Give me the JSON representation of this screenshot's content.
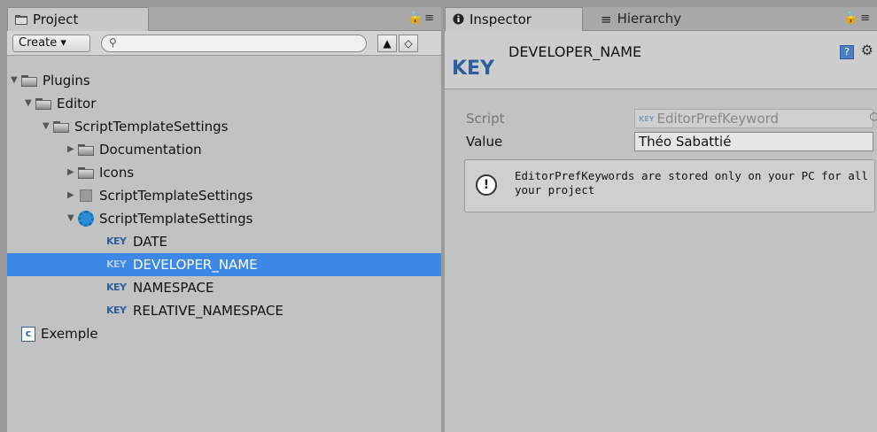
{
  "project": {
    "tab_label": "Project",
    "create_label": "Create ▾",
    "search_placeholder": "",
    "tree": [
      {
        "label": "Plugins",
        "type": "folder",
        "expanded": true
      },
      {
        "label": "Editor",
        "type": "folder",
        "expanded": true
      },
      {
        "label": "ScriptTemplateSettings",
        "type": "folder",
        "expanded": true
      },
      {
        "label": "Documentation",
        "type": "folder",
        "expanded": false
      },
      {
        "label": "Icons",
        "type": "folder",
        "expanded": false
      },
      {
        "label": "ScriptTemplateSettings",
        "type": "script",
        "expanded": false
      },
      {
        "label": "ScriptTemplateSettings",
        "type": "asset",
        "expanded": true
      },
      {
        "label": "DATE",
        "type": "key"
      },
      {
        "label": "DEVELOPER_NAME",
        "type": "key",
        "selected": true
      },
      {
        "label": "NAMESPACE",
        "type": "key"
      },
      {
        "label": "RELATIVE_NAMESPACE",
        "type": "key"
      },
      {
        "label": "Exemple",
        "type": "csharp"
      }
    ],
    "key_badge": "KEY"
  },
  "inspector": {
    "tab_label": "Inspector",
    "hierarchy_tab_label": "Hierarchy",
    "big_key": "KEY",
    "title": "DEVELOPER_NAME",
    "script_label": "Script",
    "script_value": "EditorPrefKeyword",
    "script_badge": "KEY",
    "value_label": "Value",
    "value_value": "Théo Sabattié",
    "help_text": "EditorPrefKeywords are stored only on your PC for all your project"
  },
  "colors": {
    "selection": "#3d87e6",
    "key_blue": "#2d5f9e",
    "panel_bg": "#c2c2c2"
  }
}
